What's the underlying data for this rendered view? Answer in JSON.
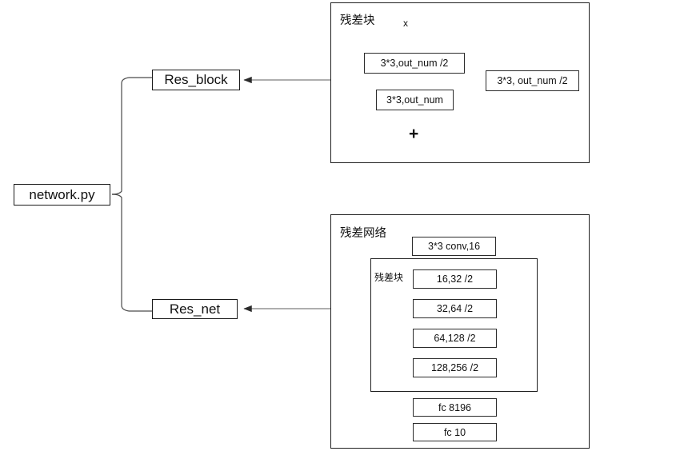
{
  "diagram": {
    "root": {
      "label": "network.py"
    },
    "branches": [
      {
        "label": "Res_block"
      },
      {
        "label": "Res_net"
      }
    ],
    "res_block_panel": {
      "title": "残差块",
      "input_label": "x",
      "main_path": [
        {
          "label": "3*3,out_num  /2"
        },
        {
          "label": "3*3,out_num"
        }
      ],
      "shortcut_path": [
        {
          "label": "3*3, out_num  /2"
        }
      ],
      "merge_symbol": "+"
    },
    "res_net_panel": {
      "title": "残差网络",
      "stem": {
        "label": "3*3 conv,16"
      },
      "group_title": "残差块",
      "blocks": [
        {
          "label": "16,32  /2"
        },
        {
          "label": "32,64  /2"
        },
        {
          "label": "64,128  /2"
        },
        {
          "label": "128,256  /2"
        }
      ],
      "head": [
        {
          "label": "fc 8196"
        },
        {
          "label": "fc 10"
        }
      ]
    }
  },
  "colors": {
    "stroke": "#7d7d7d",
    "box_border": "#1a1a1a",
    "text": "#111111",
    "background": "#ffffff"
  }
}
